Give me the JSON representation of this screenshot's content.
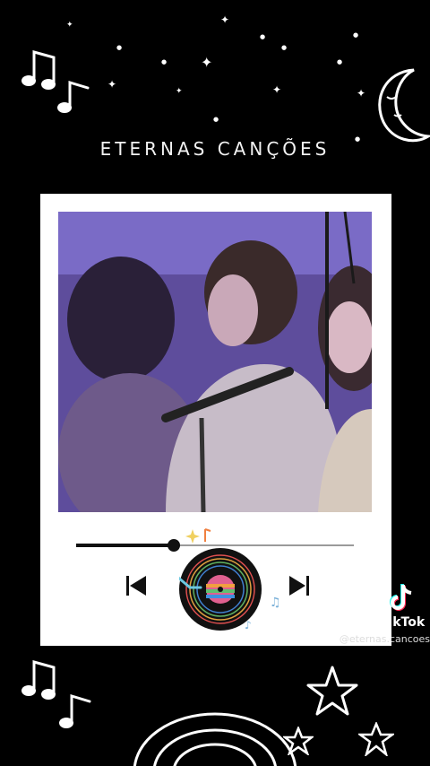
{
  "header": {
    "title": "ETERNAS CANÇÕES"
  },
  "player": {
    "progress": 0.35,
    "prev_icon": "skip-previous-icon",
    "next_icon": "skip-next-icon",
    "vinyl_icon": "vinyl-record-icon"
  },
  "watermark": {
    "brand": "TikTok",
    "handle": "@eternas.cancoes"
  },
  "colors": {
    "background": "#000000",
    "card": "#ffffff",
    "photo_tint": "#6b57ac"
  }
}
